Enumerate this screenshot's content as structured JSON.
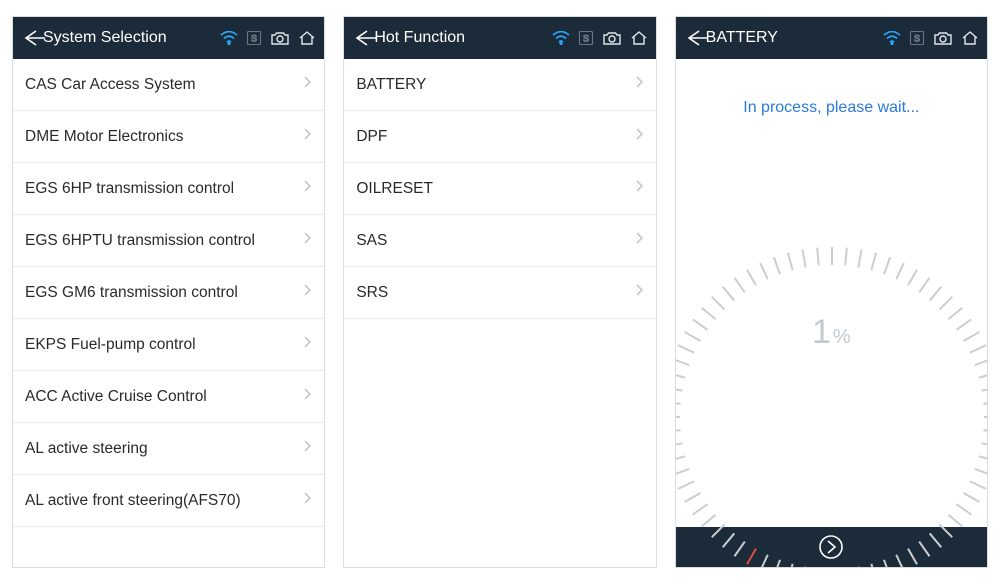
{
  "screens": [
    {
      "title": "System Selection"
    },
    {
      "title": "Hot Function"
    },
    {
      "title": "BATTERY"
    }
  ],
  "systemSelection": {
    "items": [
      {
        "label": "CAS Car Access System"
      },
      {
        "label": "DME Motor Electronics"
      },
      {
        "label": "EGS 6HP transmission control"
      },
      {
        "label": "EGS 6HPTU transmission control"
      },
      {
        "label": "EGS GM6 transmission control"
      },
      {
        "label": "EKPS Fuel-pump control"
      },
      {
        "label": "ACC Active Cruise Control"
      },
      {
        "label": "AL active steering"
      },
      {
        "label": "AL active front steering(AFS70)"
      }
    ]
  },
  "hotFunction": {
    "items": [
      {
        "label": "BATTERY"
      },
      {
        "label": "DPF"
      },
      {
        "label": "OILRESET"
      },
      {
        "label": "SAS"
      },
      {
        "label": "SRS"
      }
    ]
  },
  "battery": {
    "message": "In process, please wait...",
    "progressValue": "1",
    "progressUnit": "%"
  }
}
